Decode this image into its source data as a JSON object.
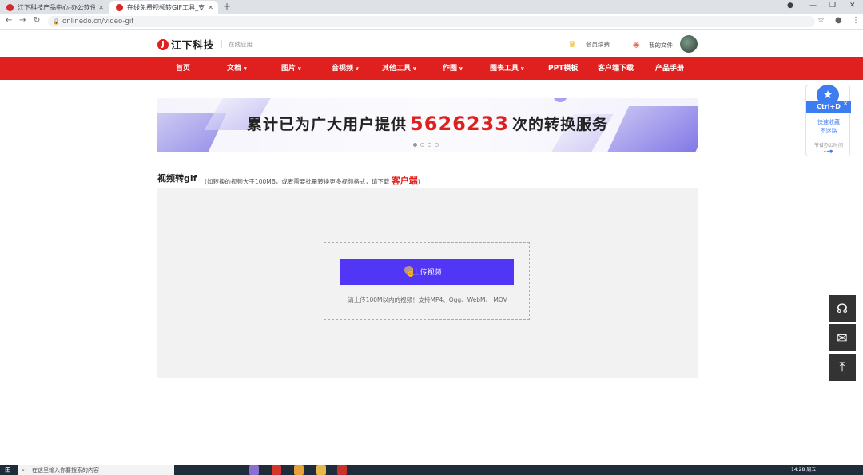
{
  "browser": {
    "tabs": [
      {
        "title": "江下科技产品中心-办公软件下载",
        "active": false
      },
      {
        "title": "在线免费视频转GIF工具_支持 [-",
        "active": true
      }
    ],
    "url": "onlinedo.cn/video-gif"
  },
  "header": {
    "logo_text": "江下科技",
    "subtitle": "在线应用",
    "member_link": "会员续费",
    "files_link": "我的文件"
  },
  "nav": {
    "items": [
      {
        "label": "首页",
        "dropdown": false
      },
      {
        "label": "文档",
        "dropdown": true
      },
      {
        "label": "图片",
        "dropdown": true
      },
      {
        "label": "音视频",
        "dropdown": true
      },
      {
        "label": "其他工具",
        "dropdown": true
      },
      {
        "label": "作图",
        "dropdown": true
      },
      {
        "label": "图表工具",
        "dropdown": true
      },
      {
        "label": "PPT模板",
        "dropdown": false
      },
      {
        "label": "客户端下载",
        "dropdown": false
      },
      {
        "label": "产品手册",
        "dropdown": false
      }
    ]
  },
  "banner": {
    "prefix": "累计已为广大用户提供",
    "count": "5626233",
    "suffix": "次的转换服务",
    "slides": 4,
    "active_slide": 0
  },
  "tool": {
    "title": "视频转gif",
    "note_prefix": "(如转换的视频大于100MB，或者需要批量转换更多视频格式，请下载",
    "note_link": "客户端",
    "note_suffix": ")",
    "upload_label": "上传视频",
    "upload_hint": "请上传100M以内的视频！支持MP4、Ogg、WebM、 MOV"
  },
  "ctrl_widget": {
    "title": "Ctrl+D",
    "line1": "快速收藏",
    "line2": "不迷路",
    "footer": "节省办公时间"
  },
  "taskbar": {
    "search_placeholder": "在这里输入你要搜索的内容",
    "time": "14:28 周五"
  },
  "colors": {
    "brand_red": "#e0201e",
    "upload_purple": "#5236f5",
    "widget_blue": "#3e7df1"
  }
}
